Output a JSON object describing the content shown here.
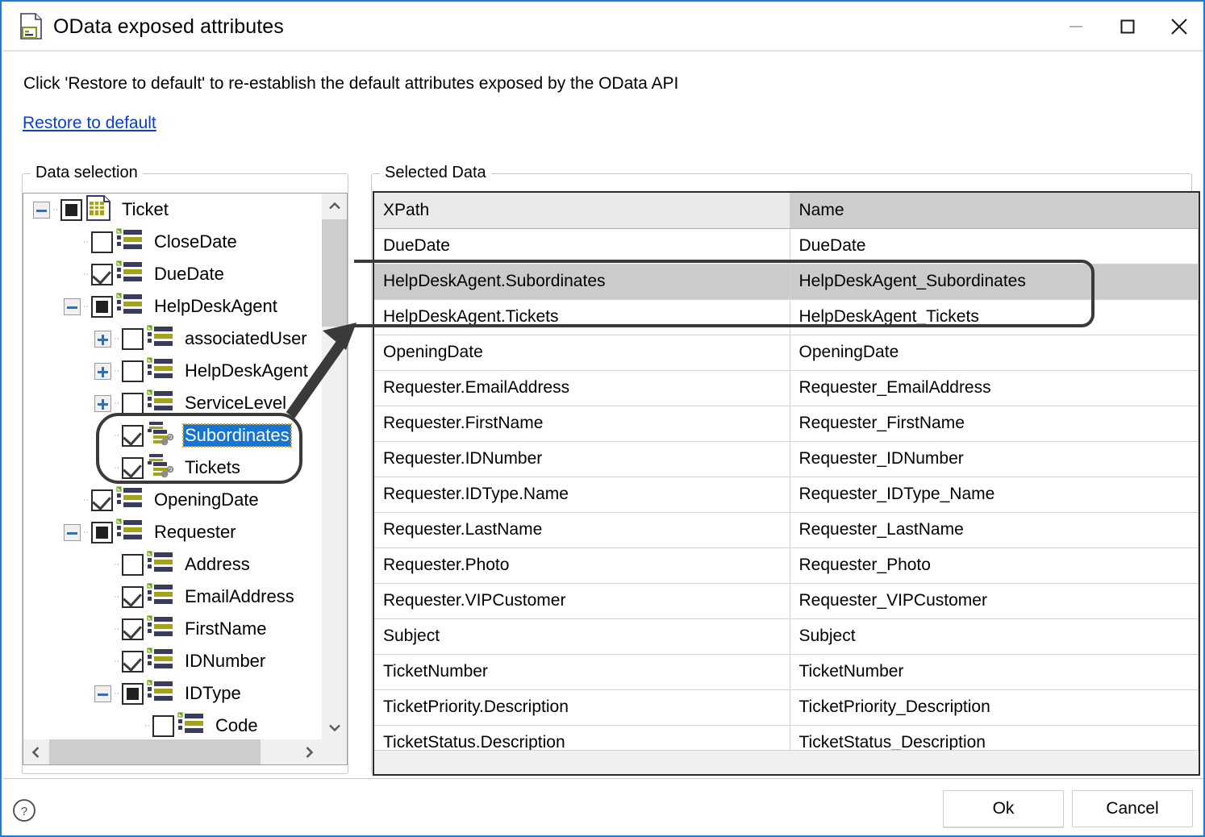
{
  "window": {
    "title": "OData exposed attributes",
    "icon": "document-attributes-icon",
    "minimize_label": "–",
    "maximize_label": "☐",
    "close_label": "✕"
  },
  "instructions": "Click 'Restore to default' to re-establish the default attributes exposed by the OData API",
  "restore_link": "Restore to default",
  "left_group": {
    "legend": "Data selection",
    "tree": [
      {
        "label": "Ticket",
        "depth": 0,
        "expander": "minus",
        "check": "partial",
        "icon": "entity-icon"
      },
      {
        "label": "CloseDate",
        "depth": 1,
        "expander": "none",
        "check": "unchecked",
        "icon": "attribute-icon"
      },
      {
        "label": "DueDate",
        "depth": 1,
        "expander": "none",
        "check": "checked",
        "icon": "attribute-icon"
      },
      {
        "label": "HelpDeskAgent",
        "depth": 1,
        "expander": "minus",
        "check": "partial",
        "icon": "attribute-icon"
      },
      {
        "label": "associatedUser",
        "depth": 2,
        "expander": "plus",
        "check": "unchecked",
        "icon": "attribute-icon"
      },
      {
        "label": "HelpDeskAgent",
        "depth": 2,
        "expander": "plus",
        "check": "unchecked",
        "icon": "attribute-icon"
      },
      {
        "label": "ServiceLevel",
        "depth": 2,
        "expander": "plus",
        "check": "unchecked",
        "icon": "attribute-icon"
      },
      {
        "label": "Subordinates",
        "depth": 2,
        "expander": "none",
        "check": "checked",
        "icon": "relation-icon",
        "selected": true
      },
      {
        "label": "Tickets",
        "depth": 2,
        "expander": "none",
        "check": "checked",
        "icon": "relation-icon"
      },
      {
        "label": "OpeningDate",
        "depth": 1,
        "expander": "none",
        "check": "checked",
        "icon": "attribute-icon"
      },
      {
        "label": "Requester",
        "depth": 1,
        "expander": "minus",
        "check": "partial",
        "icon": "attribute-icon"
      },
      {
        "label": "Address",
        "depth": 2,
        "expander": "none",
        "check": "unchecked",
        "icon": "attribute-icon"
      },
      {
        "label": "EmailAddress",
        "depth": 2,
        "expander": "none",
        "check": "checked",
        "icon": "attribute-icon"
      },
      {
        "label": "FirstName",
        "depth": 2,
        "expander": "none",
        "check": "checked",
        "icon": "attribute-icon"
      },
      {
        "label": "IDNumber",
        "depth": 2,
        "expander": "none",
        "check": "checked",
        "icon": "attribute-icon"
      },
      {
        "label": "IDType",
        "depth": 2,
        "expander": "minus",
        "check": "partial",
        "icon": "attribute-icon"
      },
      {
        "label": "Code",
        "depth": 3,
        "expander": "none",
        "check": "unchecked",
        "icon": "attribute-icon"
      }
    ],
    "scroll_up_icon": "chevron-up-icon",
    "scroll_down_icon": "chevron-down-icon",
    "scroll_left_icon": "chevron-left-icon",
    "scroll_right_icon": "chevron-right-icon"
  },
  "right_group": {
    "legend": "Selected Data",
    "columns": [
      "XPath",
      "Name"
    ],
    "rows": [
      {
        "xpath": "DueDate",
        "name": "DueDate"
      },
      {
        "xpath": "HelpDeskAgent.Subordinates",
        "name": "HelpDeskAgent_Subordinates",
        "selected": true
      },
      {
        "xpath": "HelpDeskAgent.Tickets",
        "name": "HelpDeskAgent_Tickets"
      },
      {
        "xpath": "OpeningDate",
        "name": "OpeningDate"
      },
      {
        "xpath": "Requester.EmailAddress",
        "name": "Requester_EmailAddress"
      },
      {
        "xpath": "Requester.FirstName",
        "name": "Requester_FirstName"
      },
      {
        "xpath": "Requester.IDNumber",
        "name": "Requester_IDNumber"
      },
      {
        "xpath": "Requester.IDType.Name",
        "name": "Requester_IDType_Name"
      },
      {
        "xpath": "Requester.LastName",
        "name": "Requester_LastName"
      },
      {
        "xpath": "Requester.Photo",
        "name": "Requester_Photo"
      },
      {
        "xpath": "Requester.VIPCustomer",
        "name": "Requester_VIPCustomer"
      },
      {
        "xpath": "Subject",
        "name": "Subject"
      },
      {
        "xpath": "TicketNumber",
        "name": "TicketNumber"
      },
      {
        "xpath": "TicketPriority.Description",
        "name": "TicketPriority_Description"
      },
      {
        "xpath": "TicketStatus.Description",
        "name": "TicketStatus_Description"
      }
    ]
  },
  "footer": {
    "help_icon": "help-question-icon",
    "ok_label": "Ok",
    "cancel_label": "Cancel"
  },
  "colors": {
    "window_border": "#1a7fd4",
    "link": "#0b3fd1",
    "selection": "#1675d0",
    "row_selected": "#cbcbcb",
    "annotation": "#3a3a3a"
  }
}
